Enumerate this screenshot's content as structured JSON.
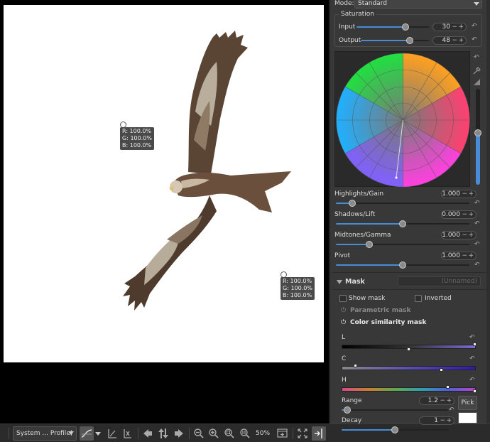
{
  "canvas": {
    "probes": [
      {
        "r": "R: 100.0%",
        "g": "G: 100.0%",
        "b": "B: 100.0%"
      },
      {
        "r": "R: 100.0%",
        "g": "G: 100.0%",
        "b": "B: 100.0%"
      }
    ]
  },
  "toolbar": {
    "profile": "System ... Profile)",
    "zoom": "50%"
  },
  "panel": {
    "mode_label": "Mode:",
    "mode_value": "Standard",
    "saturation": {
      "title": "Saturation",
      "input_label": "Input",
      "input_value": "30",
      "input_fraction": 0.68,
      "output_label": "Output",
      "output_value": "48",
      "output_fraction": 0.72
    },
    "wheel": {
      "brightness_fraction": 0.54
    },
    "highlights": {
      "label": "Highlights/Gain",
      "value": "1.000",
      "fraction": 0.12
    },
    "shadows": {
      "label": "Shadows/Lift",
      "value": "0.000",
      "fraction": 0.5
    },
    "midtones": {
      "label": "Midtones/Gamma",
      "value": "1.000",
      "fraction": 0.25
    },
    "pivot": {
      "label": "Pivot",
      "value": "1.000",
      "fraction": 0.5
    },
    "mask": {
      "title": "Mask",
      "name_placeholder": "(Unnamed)",
      "show_mask": "Show mask",
      "inverted": "Inverted",
      "parametric": "Parametric mask",
      "color_similarity": "Color similarity mask",
      "l_label": "L",
      "c_label": "C",
      "h_label": "H",
      "range_label": "Range",
      "range_value": "1.2",
      "range_fraction": 0.05,
      "decay_label": "Decay",
      "decay_value": "1",
      "decay_fraction": 0.5,
      "pick": "Pick",
      "minus": "−",
      "plus": "+"
    }
  },
  "colors": {
    "accent": "#4a8bd8",
    "panel_bg": "#383838",
    "toolbar_bg": "#2b2b2b"
  }
}
